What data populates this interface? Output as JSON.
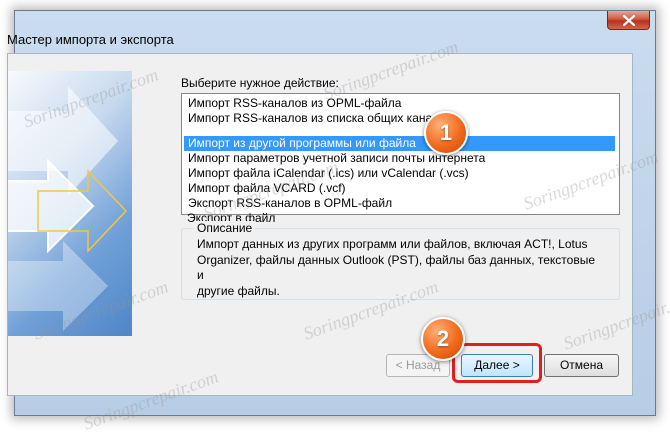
{
  "window": {
    "title": "Мастер импорта и экспорта"
  },
  "prompt": "Выберите нужное действие:",
  "actions": [
    "Импорт RSS-каналов из OPML-файла",
    "Импорт RSS-каналов из списка общих каналов",
    "Импорт из другой программы или файла",
    "Импорт параметров учетной записи почты интернета",
    "Импорт файла iCalendar (.ics) или vCalendar (.vcs)",
    "Импорт файла VCARD (.vcf)",
    "Экспорт RSS-каналов в OPML-файл",
    "Экспорт в файл"
  ],
  "selected_action": "Импорт из другой программы или файла",
  "description": {
    "caption": "Описание",
    "lines": [
      "Импорт данных из других программ или файлов, включая ACT!, Lotus",
      "Organizer, файлы данных Outlook (PST), файлы баз данных, текстовые и",
      "другие файлы."
    ]
  },
  "buttons": {
    "back": "< Назад",
    "next": "Далее >",
    "cancel": "Отмена"
  },
  "markers": [
    "1",
    "2"
  ],
  "watermark": "Soringpcrepair.com",
  "colors": {
    "selection": "#3399ff",
    "highlight": "#e31d1d",
    "marker": "#f26a1b"
  },
  "icons": {
    "close": "close-icon",
    "wizard_art": "arrows-graphic"
  }
}
